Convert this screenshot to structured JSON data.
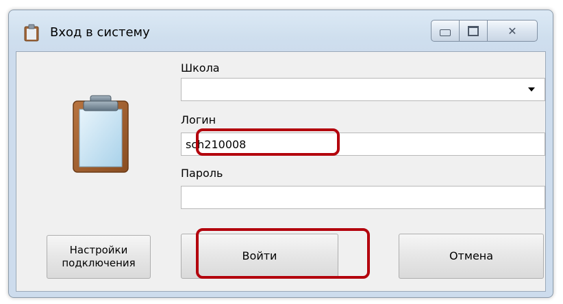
{
  "window": {
    "title": "Вход в систему",
    "controls": {
      "minimize": "▭",
      "maximize": "▣",
      "close": "✕"
    }
  },
  "form": {
    "school_label": "Школа",
    "school_value": "",
    "login_label": "Логин",
    "login_value": "sch210008",
    "password_label": "Пароль",
    "password_value": ""
  },
  "buttons": {
    "settings": "Настройки подключения",
    "login": "Войти",
    "cancel": "Отмена"
  },
  "colors": {
    "highlight": "#b3000c"
  },
  "icons": {
    "title": "clipboard-icon",
    "main": "clipboard-icon"
  }
}
